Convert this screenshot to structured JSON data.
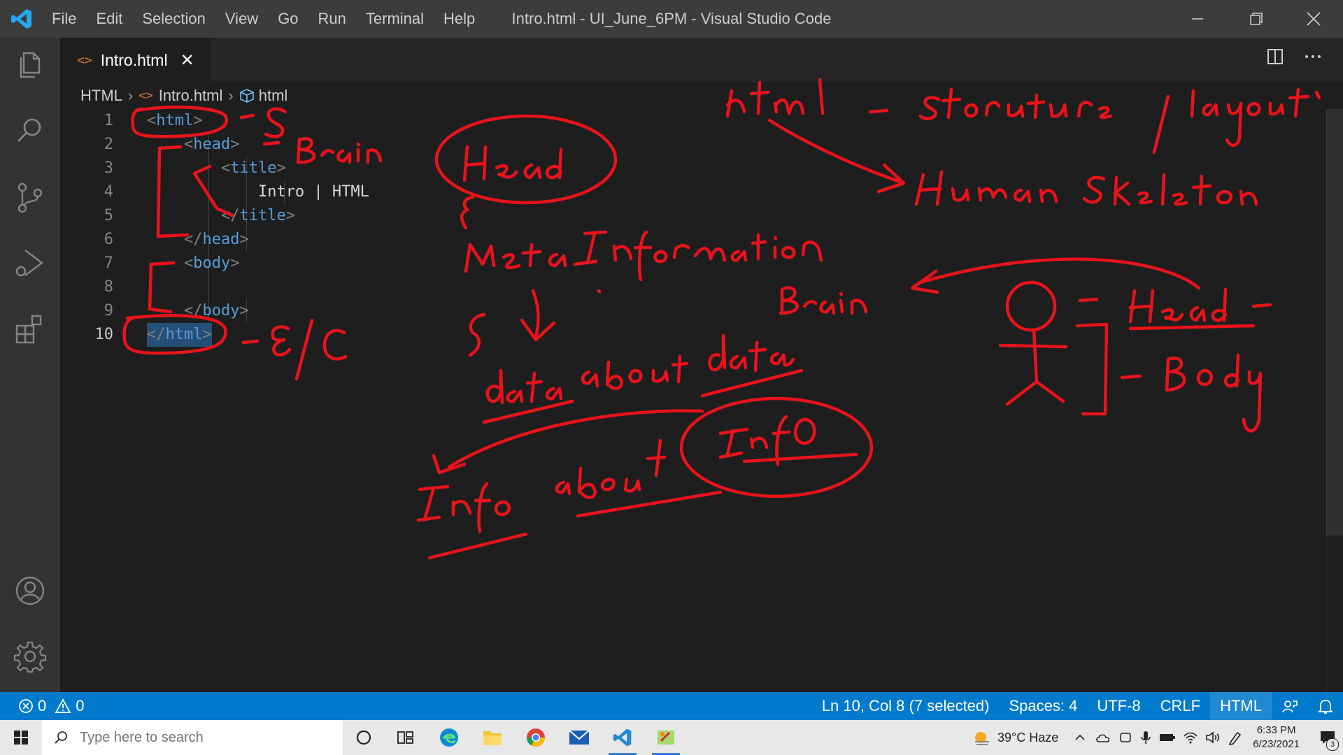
{
  "window": {
    "title": "Intro.html - UI_June_6PM - Visual Studio Code",
    "menu": [
      "File",
      "Edit",
      "Selection",
      "View",
      "Go",
      "Run",
      "Terminal",
      "Help"
    ]
  },
  "activity_bar": {
    "icons": [
      "explorer-icon",
      "search-icon",
      "source-control-icon",
      "run-debug-icon",
      "extensions-icon",
      "account-icon",
      "settings-gear-icon"
    ]
  },
  "tab": {
    "icon": "<>",
    "label": "Intro.html",
    "close": "✕"
  },
  "breadcrumb": {
    "root": "HTML",
    "file": "Intro.html",
    "symbol": "html"
  },
  "editor": {
    "lines": [
      {
        "num": "1",
        "indent": "",
        "open": "<",
        "tag": "html",
        "close": ">"
      },
      {
        "num": "2",
        "indent": "    ",
        "open": "<",
        "tag": "head",
        "close": ">"
      },
      {
        "num": "3",
        "indent": "        ",
        "open": "<",
        "tag": "title",
        "close": ">"
      },
      {
        "num": "4",
        "indent": "            ",
        "text": "Intro | HTML"
      },
      {
        "num": "5",
        "indent": "        ",
        "open": "</",
        "tag": "title",
        "close": ">"
      },
      {
        "num": "6",
        "indent": "    ",
        "open": "</",
        "tag": "head",
        "close": ">"
      },
      {
        "num": "7",
        "indent": "    ",
        "open": "<",
        "tag": "body",
        "close": ">"
      },
      {
        "num": "8",
        "indent": "",
        "text": ""
      },
      {
        "num": "9",
        "indent": "    ",
        "open": "</",
        "tag": "body",
        "close": ">"
      },
      {
        "num": "10",
        "indent": "",
        "open": "</",
        "tag": "html",
        "close": ">"
      }
    ],
    "active_line": "10"
  },
  "annotations": {
    "color": "#e8131b"
  },
  "statusbar": {
    "errors": "0",
    "warnings": "0",
    "position": "Ln 10, Col 8 (7 selected)",
    "spaces": "Spaces: 4",
    "encoding": "UTF-8",
    "eol": "CRLF",
    "language": "HTML",
    "colors": {
      "background": "#007acc"
    }
  },
  "taskbar": {
    "search_placeholder": "Type here to search",
    "apps": [
      "cortana-icon",
      "task-view-icon",
      "edge-icon",
      "file-explorer-icon",
      "chrome-icon",
      "mail-icon",
      "vscode-icon",
      "paint-icon"
    ],
    "weather": "39°C  Haze",
    "time": "6:33 PM",
    "date": "6/23/2021",
    "notifications": "3"
  }
}
